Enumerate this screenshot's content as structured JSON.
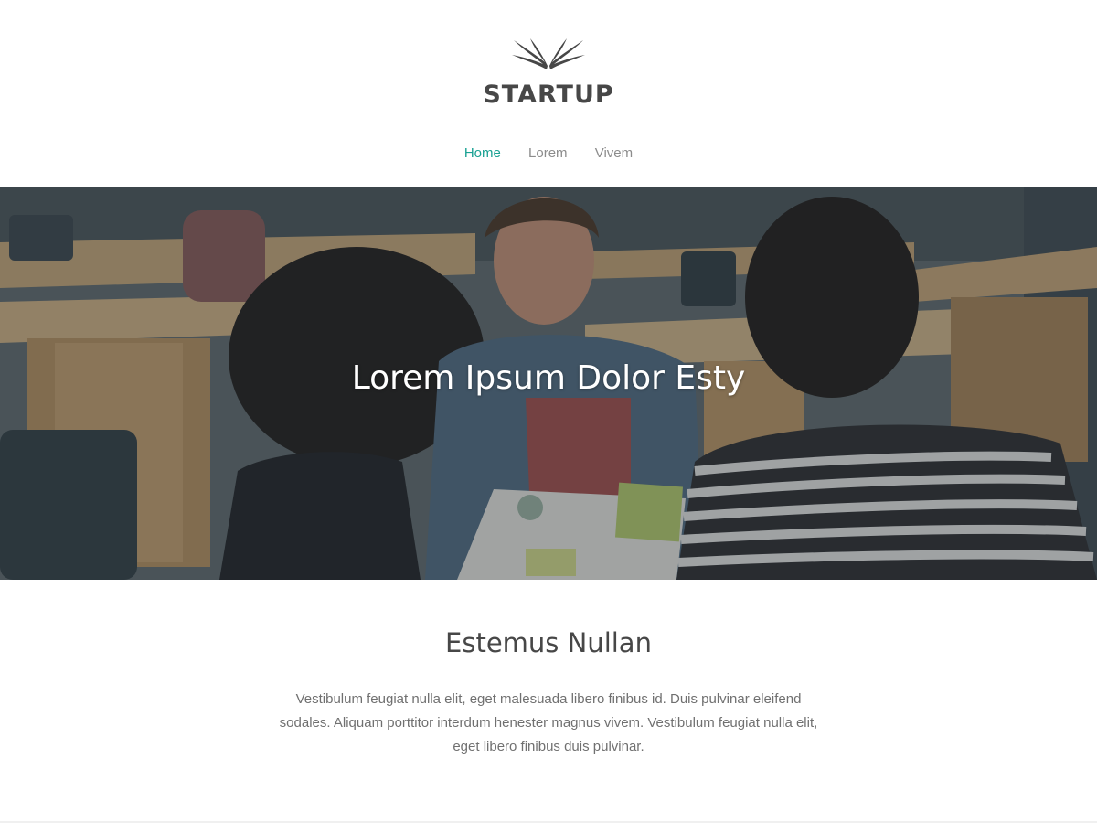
{
  "brand": {
    "logo_icon": "wings-icon",
    "name": "STARTUP"
  },
  "nav": {
    "items": [
      {
        "label": "Home",
        "active": true
      },
      {
        "label": "Lorem",
        "active": false
      },
      {
        "label": "Vivem",
        "active": false
      }
    ]
  },
  "hero": {
    "title": "Lorem Ipsum Dolor Esty"
  },
  "section": {
    "title": "Estemus Nullan",
    "body": "Vestibulum feugiat nulla elit, eget malesuada libero finibus id. Duis pulvinar eleifend sodales. Aliquam porttitor interdum henester magnus vivem. Vestibulum feugiat nulla elit, eget libero finibus duis pulvinar."
  },
  "colors": {
    "accent": "#1aa193",
    "nav_text": "#8c8c8c",
    "heading": "#474747",
    "body_text": "#707070"
  }
}
